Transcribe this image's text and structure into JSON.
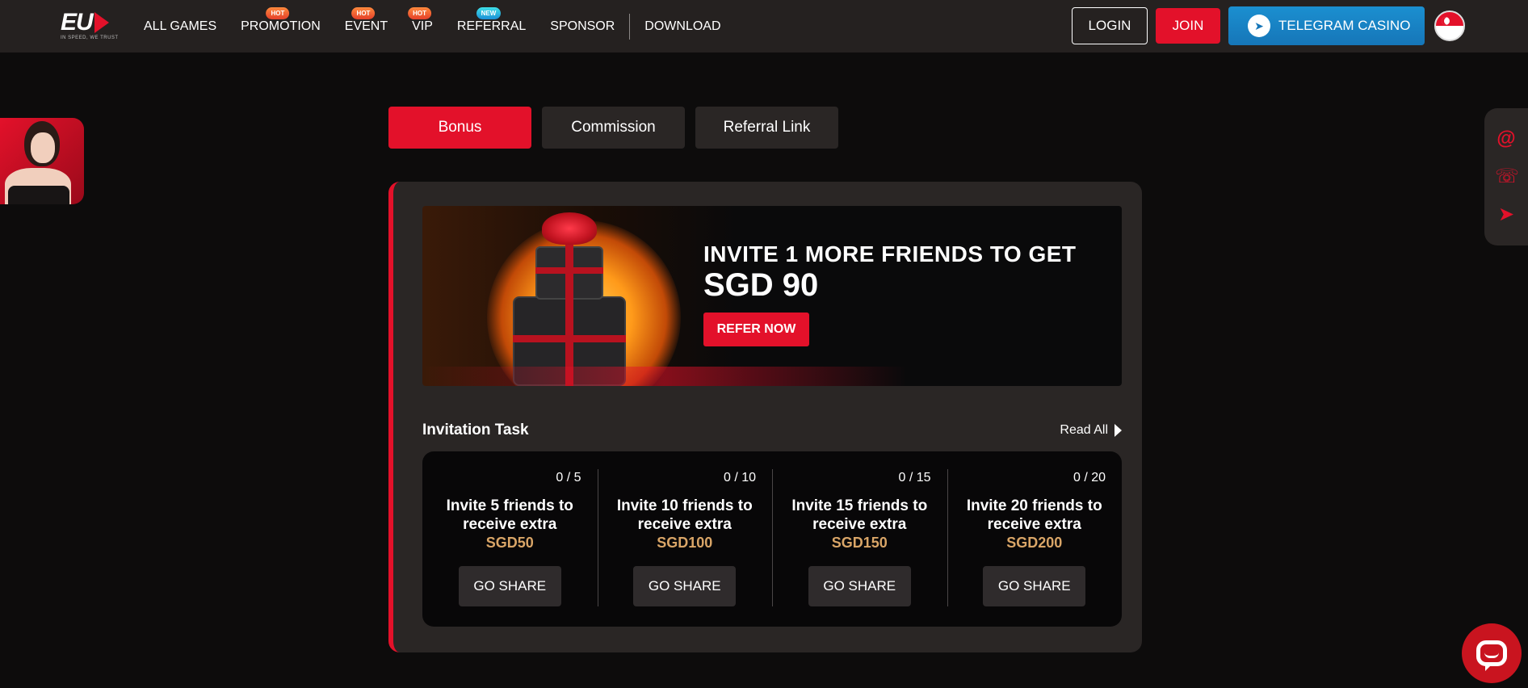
{
  "header": {
    "logo_text": "EU",
    "logo_slogan": "IN SPEED, WE TRUST",
    "nav": [
      {
        "label": "ALL GAMES",
        "badge": ""
      },
      {
        "label": "PROMOTION",
        "badge": "HOT"
      },
      {
        "label": "EVENT",
        "badge": "HOT"
      },
      {
        "label": "VIP",
        "badge": "HOT"
      },
      {
        "label": "REFERRAL",
        "badge": "NEW"
      },
      {
        "label": "SPONSOR",
        "badge": ""
      },
      {
        "label": "DOWNLOAD",
        "badge": ""
      }
    ],
    "login_label": "LOGIN",
    "join_label": "JOIN",
    "telegram_label": "TELEGRAM CASINO"
  },
  "tabs": [
    {
      "label": "Bonus",
      "active": true
    },
    {
      "label": "Commission",
      "active": false
    },
    {
      "label": "Referral Link",
      "active": false
    }
  ],
  "banner": {
    "line1": "INVITE 1 MORE FRIENDS TO GET",
    "line2": "SGD 90",
    "button": "REFER NOW"
  },
  "invitation": {
    "title": "Invitation Task",
    "read_all": "Read All",
    "tasks": [
      {
        "progress": "0 / 5",
        "desc": "Invite 5 friends to receive extra",
        "amount": "SGD50",
        "button": "GO SHARE"
      },
      {
        "progress": "0 / 10",
        "desc": "Invite 10 friends to receive extra",
        "amount": "SGD100",
        "button": "GO SHARE"
      },
      {
        "progress": "0 / 15",
        "desc": "Invite 15 friends to receive extra",
        "amount": "SGD150",
        "button": "GO SHARE"
      },
      {
        "progress": "0 / 20",
        "desc": "Invite 20 friends to receive extra",
        "amount": "SGD200",
        "button": "GO SHARE"
      }
    ]
  },
  "colors": {
    "accent": "#e3112a",
    "gold": "#d9a567",
    "telegram": "#1b8fd0"
  },
  "icons": {
    "side": [
      "email-icon",
      "whatsapp-icon",
      "telegram-icon"
    ],
    "chat": "chat-icon"
  }
}
